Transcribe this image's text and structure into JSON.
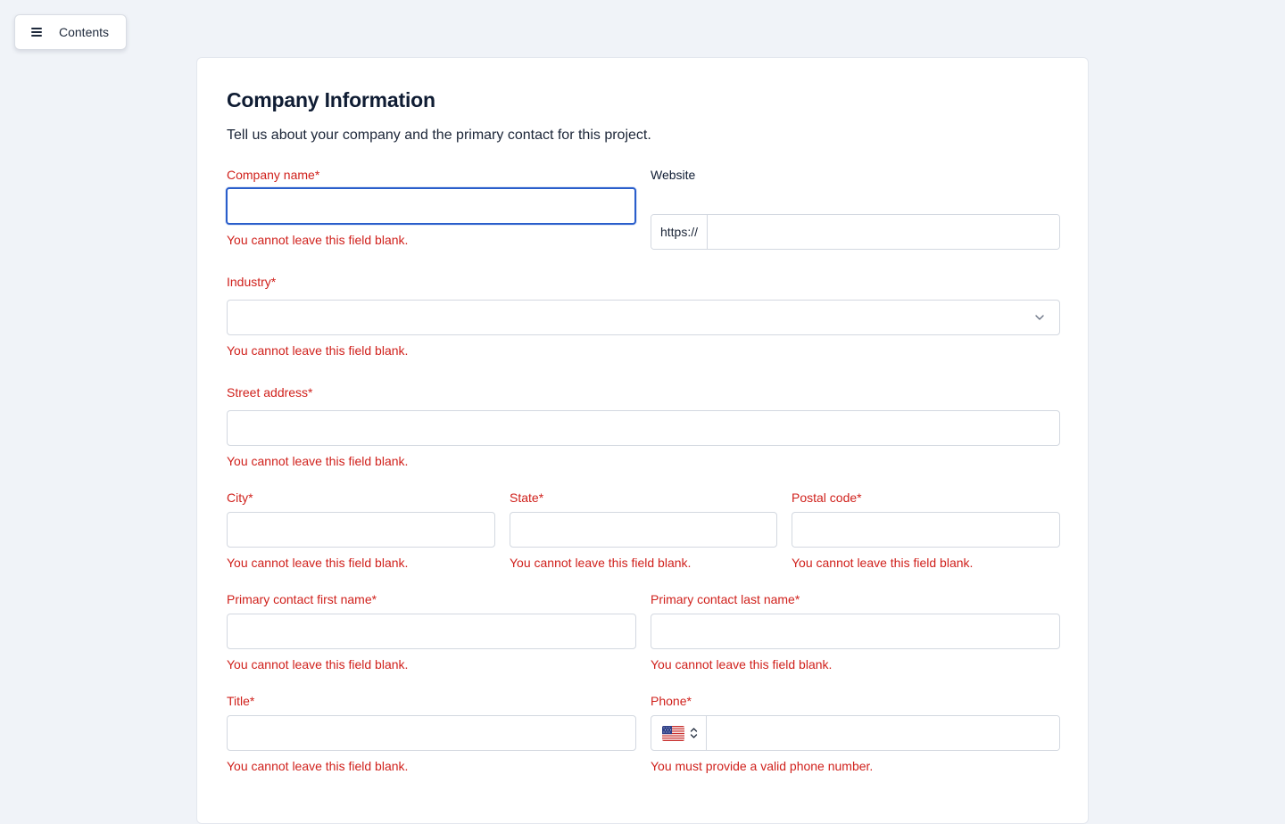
{
  "nav": {
    "contents_label": "Contents"
  },
  "form": {
    "title": "Company Information",
    "subtitle": "Tell us about your company and the primary contact for this project.",
    "fields": {
      "company_name": {
        "label": "Company name*",
        "value": "",
        "error": "You cannot leave this field blank."
      },
      "website": {
        "label": "Website",
        "prefix": "https://",
        "value": ""
      },
      "industry": {
        "label": "Industry*",
        "value": "",
        "error": "You cannot leave this field blank."
      },
      "street_address": {
        "label": "Street address*",
        "value": "",
        "error": "You cannot leave this field blank."
      },
      "city": {
        "label": "City*",
        "value": "",
        "error": "You cannot leave this field blank."
      },
      "state": {
        "label": "State*",
        "value": "",
        "error": "You cannot leave this field blank."
      },
      "postal_code": {
        "label": "Postal code*",
        "value": "",
        "error": "You cannot leave this field blank."
      },
      "first_name": {
        "label": "Primary contact first name*",
        "value": "",
        "error": "You cannot leave this field blank."
      },
      "last_name": {
        "label": "Primary contact last name*",
        "value": "",
        "error": "You cannot leave this field blank."
      },
      "title": {
        "label": "Title*",
        "value": "",
        "error": "You cannot leave this field blank."
      },
      "phone": {
        "label": "Phone*",
        "country_icon": "us-flag-icon",
        "value": "",
        "error": "You must provide a valid phone number."
      }
    }
  },
  "colors": {
    "error": "#d0211c",
    "focus": "#2a5ecb",
    "background": "#f0f3f8"
  }
}
